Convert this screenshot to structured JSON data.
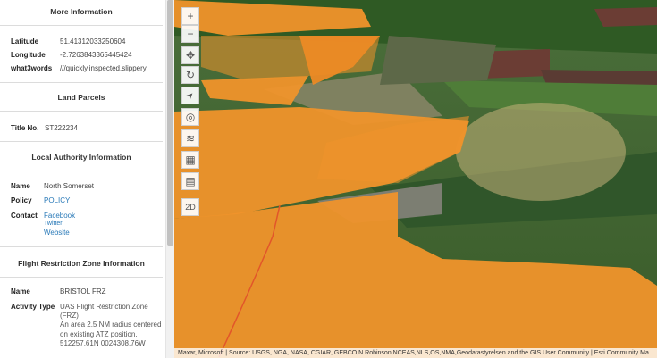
{
  "more_info": {
    "title": "More Information",
    "latitude_label": "Latitude",
    "latitude_value": "51.41312033250604",
    "longitude_label": "Longitude",
    "longitude_value": "-2.7263843365445424",
    "w3w_label": "what3words",
    "w3w_value": "///quickly.inspected.slippery"
  },
  "land_parcels": {
    "title": "Land Parcels",
    "title_no_label": "Title No.",
    "title_no_value": "ST222234"
  },
  "local_authority": {
    "title": "Local Authority Information",
    "name_label": "Name",
    "name_value": "North Somerset",
    "policy_label": "Policy",
    "policy_value": "POLICY",
    "contact_label": "Contact",
    "contact_links": [
      "Facebook",
      "Twitter",
      "Website"
    ]
  },
  "flight_zone": {
    "title": "Flight Restriction Zone Information",
    "name_label": "Name",
    "name_value": "BRISTOL FRZ",
    "activity_label": "Activity Type",
    "activity_value": "UAS Flight Restriction Zone (FRZ)\nAn area 2.5 NM radius centered on existing ATZ position.\n512257.61N 0024308.76W"
  },
  "map": {
    "toolbar": [
      {
        "name": "zoom-in-button",
        "icon": "plus-icon",
        "glyph": "+"
      },
      {
        "name": "zoom-out-button",
        "icon": "minus-icon",
        "glyph": "−"
      },
      {
        "name": "pan-button",
        "icon": "move-icon",
        "glyph": "✥"
      },
      {
        "name": "rotate-button",
        "icon": "rotate-icon",
        "glyph": "↻"
      },
      {
        "name": "compass-button",
        "icon": "compass-icon",
        "glyph": "➤"
      },
      {
        "name": "locate-button",
        "icon": "locate-icon",
        "glyph": "◎"
      },
      {
        "name": "layers-button",
        "icon": "layers-icon",
        "glyph": "≋"
      },
      {
        "name": "basemap-gallery-button",
        "icon": "grid-icon",
        "glyph": "▦"
      },
      {
        "name": "save-button",
        "icon": "save-icon",
        "glyph": "▤"
      },
      {
        "name": "view-2d-button",
        "icon": "",
        "glyph": "2D"
      }
    ],
    "attribution": "Maxar, Microsoft | Source: USGS, NGA, NASA, CGIAR, GEBCO,N Robinson,NCEAS,NLS,OS,NMA,Geodatastyrelsen and the GIS User Community | Esri Community Ma",
    "colors": {
      "zone": "#f0932b",
      "field_dark": "#2f5a24",
      "field_light": "#5f8d3c"
    }
  }
}
